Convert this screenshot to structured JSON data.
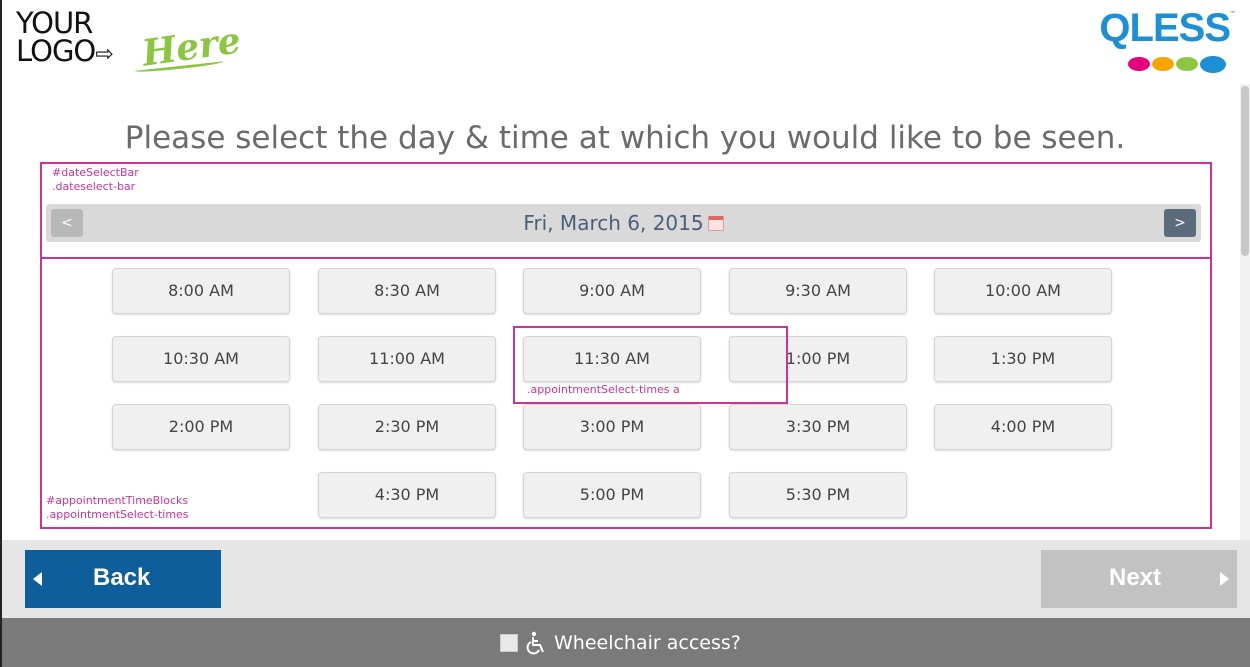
{
  "header": {
    "logo_line1": "YOUR",
    "logo_line2": "LOGO",
    "logo_here": "Here",
    "brand": "QLESS",
    "brand_tm": "™",
    "brand_dot_colors": [
      "#e6007e",
      "#f7a600",
      "#8cc63f",
      "#1d8fd6"
    ]
  },
  "title": "Please select the day & time at which you would like to be seen.",
  "date_bar": {
    "prev_label": "<",
    "next_label": ">",
    "date": "Fri, March 6, 2015",
    "annotation_id": "#dateSelectBar",
    "annotation_class": ".dateselect-bar"
  },
  "time_blocks": {
    "annotation_id": "#appointmentTimeBlocks",
    "annotation_class": ".appointmentSelect-times",
    "button_annotation": ".appointmentSelect-times a",
    "times": [
      "8:00 AM",
      "8:30 AM",
      "9:00 AM",
      "9:30 AM",
      "10:00 AM",
      "10:30 AM",
      "11:00 AM",
      "11:30 AM",
      "1:00 PM",
      "1:30 PM",
      "2:00 PM",
      "2:30 PM",
      "3:00 PM",
      "3:30 PM",
      "4:00 PM",
      "4:30 PM",
      "5:00 PM",
      "5:30 PM"
    ]
  },
  "nav": {
    "back_label": "Back",
    "next_label": "Next"
  },
  "footer": {
    "wheelchair_label": "Wheelchair access?"
  },
  "colors": {
    "accent_blue": "#0f5e9c",
    "annotation_magenta": "#cc3399",
    "disabled_grey": "#c2c2c2"
  }
}
